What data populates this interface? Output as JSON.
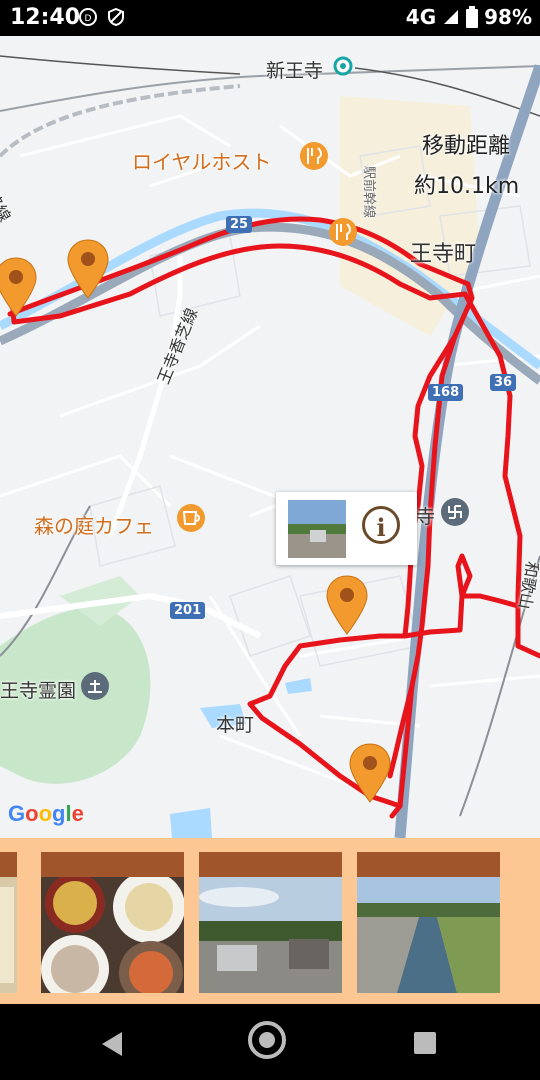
{
  "status_bar": {
    "time": "12:40",
    "network": "4G",
    "battery": "98%"
  },
  "map": {
    "places": {
      "station": "新王寺",
      "restaurant": "ロイヤルホスト",
      "cafe": "森の庭カフェ",
      "cemetery": "王寺霊園",
      "town_ouji": "王寺町",
      "town_honmachi": "本町",
      "temple_fragment": "寺",
      "rail_wazi": "和路線",
      "rail_ouji_kashiba": "王寺香芝線",
      "rail_kintetsu": "駅前幹線",
      "river_right": "和歌山"
    },
    "road_numbers": [
      "25",
      "168",
      "36",
      "201"
    ],
    "distance": {
      "label": "移動距離",
      "value": "約10.1km"
    },
    "route_color": "#e8141b",
    "pin_color": "#f29a2e",
    "google_logo": "Google"
  },
  "popup": {
    "info_symbol": "i"
  },
  "photo_strip": {
    "bg_color": "#fdc794",
    "bar_color": "#a0552a"
  }
}
